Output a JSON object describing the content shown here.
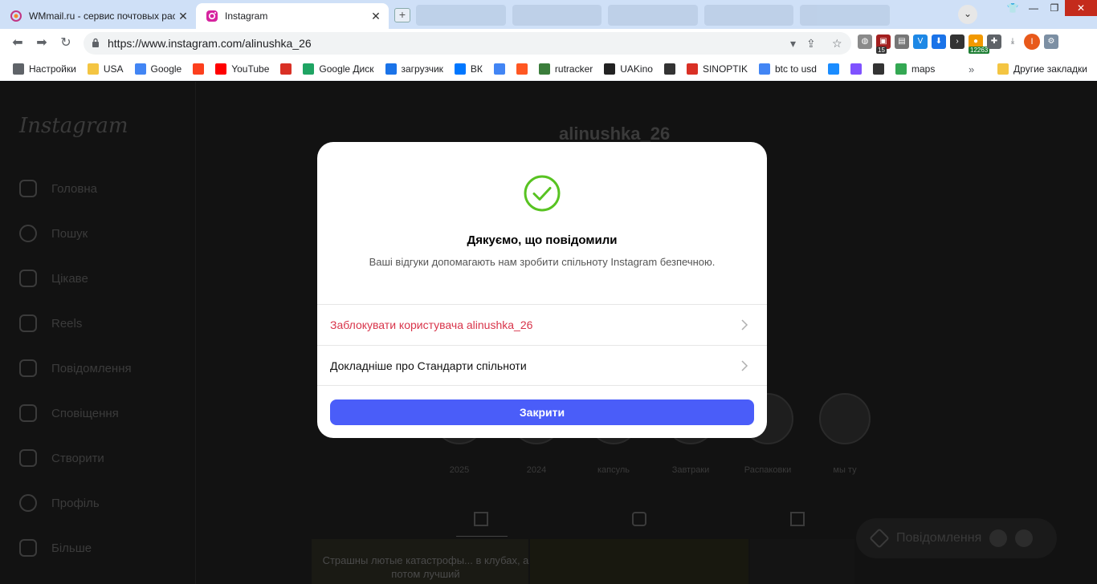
{
  "browser": {
    "tabs": [
      {
        "title": "WMmail.ru - сервис почтовых рас",
        "active": false
      },
      {
        "title": "Instagram",
        "active": true
      }
    ],
    "url": "https://www.instagram.com/alinushka_26",
    "profile_initial": "I",
    "ext_badge_count": "15",
    "ext_badge_coins": "12263",
    "bookmarks": [
      {
        "label": "Настройки",
        "icon": "gear-icon",
        "color": "#5f6368"
      },
      {
        "label": "USA",
        "icon": "folder-icon",
        "color": "#f4c542"
      },
      {
        "label": "Google",
        "icon": "google-icon",
        "color": "#4285f4"
      },
      {
        "label": "",
        "icon": "yandex-icon",
        "color": "#fc3f1d"
      },
      {
        "label": "YouTube",
        "icon": "youtube-icon",
        "color": "#ff0000"
      },
      {
        "label": "",
        "icon": "gmail-icon",
        "color": "#d93025"
      },
      {
        "label": "Google Диск",
        "icon": "google-drive-icon",
        "color": "#1fa463"
      },
      {
        "label": "загрузчик",
        "icon": "infinity-icon",
        "color": "#1a73e8"
      },
      {
        "label": "ВК",
        "icon": "vk-icon",
        "color": "#0077ff"
      },
      {
        "label": "",
        "icon": "translate-icon",
        "color": "#4285f4"
      },
      {
        "label": "",
        "icon": "f-icon",
        "color": "#ff5722"
      },
      {
        "label": "rutracker",
        "icon": "rutracker-icon",
        "color": "#3b7d3b"
      },
      {
        "label": "UAKino",
        "icon": "uakino-icon",
        "color": "#222222"
      },
      {
        "label": "",
        "icon": "chess-icon",
        "color": "#333333"
      },
      {
        "label": "SINOPTIK",
        "icon": "thermometer-icon",
        "color": "#d93025"
      },
      {
        "label": "btc to usd",
        "icon": "google-icon",
        "color": "#4285f4"
      },
      {
        "label": "",
        "icon": "p-icon",
        "color": "#1a8cff"
      },
      {
        "label": "",
        "icon": "kotlin-icon",
        "color": "#7f52ff"
      },
      {
        "label": "",
        "icon": "bc-icon",
        "color": "#333333"
      },
      {
        "label": "maps",
        "icon": "maps-icon",
        "color": "#34a853"
      }
    ],
    "other_bookmarks": "Другие закладки",
    "more_chevron": "»"
  },
  "instagram": {
    "logo": "Instagram",
    "nav": [
      {
        "label": "Головна",
        "icon": "home-icon"
      },
      {
        "label": "Пошук",
        "icon": "search-icon"
      },
      {
        "label": "Цікаве",
        "icon": "compass-icon"
      },
      {
        "label": "Reels",
        "icon": "reels-icon"
      },
      {
        "label": "Повідомлення",
        "icon": "messenger-icon"
      },
      {
        "label": "Сповіщення",
        "icon": "heart-icon"
      },
      {
        "label": "Створити",
        "icon": "plus-icon"
      },
      {
        "label": "Профіль",
        "icon": "profile-icon"
      },
      {
        "label": "Більше",
        "icon": "menu-icon"
      }
    ],
    "username": "alinushka_26",
    "highlights": [
      "2025",
      "2024",
      "капсуль",
      "Завтраки",
      "Распаковки",
      "мы ту"
    ],
    "post_caption": "Страшны лютые катастрофы... в клубах, а потом лучший",
    "messages_pill": "Повідомлення"
  },
  "modal": {
    "title": "Дякуємо, що повідомили",
    "subtitle": "Ваші відгуки допомагають нам зробити спільноту Instagram безпечною.",
    "block_action": "Заблокувати користувача alinushka_26",
    "learn_more": "Докладніше про Стандарти спільноти",
    "close": "Закрити",
    "accent_color": "#4a5df9",
    "success_color": "#58c322",
    "danger_color": "#d8344a"
  }
}
